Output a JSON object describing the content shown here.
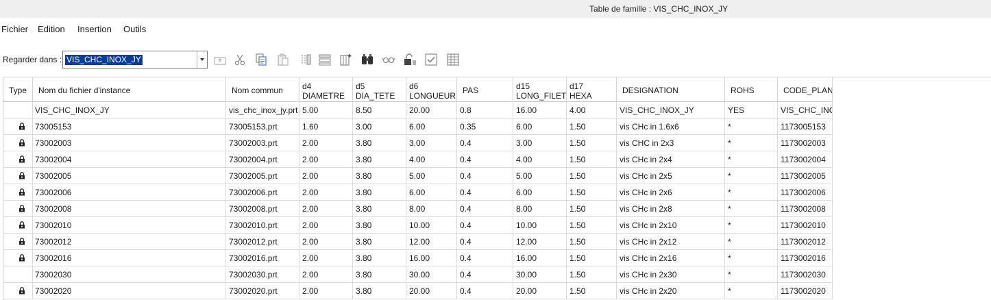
{
  "window": {
    "title": "Table de famille : VIS_CHC_INOX_JY"
  },
  "menu": {
    "items": [
      "Fichier",
      "Edition",
      "Insertion",
      "Outils"
    ]
  },
  "toolbar": {
    "look_in_label": "Regarder dans :",
    "look_in_value": "VIS_CHC_INOX_JY",
    "icons": [
      "up-level-icon",
      "cut-icon",
      "copy-icon",
      "paste-icon",
      "insert-column-icon",
      "insert-row-icon",
      "column-properties-icon",
      "find-icon",
      "preview-icon",
      "lock-icon",
      "verify-icon",
      "table-icon"
    ]
  },
  "table": {
    "columns": [
      {
        "key": "type",
        "line1": "Type",
        "line2": ""
      },
      {
        "key": "instance",
        "line1": "Nom du fichier d'instance",
        "line2": ""
      },
      {
        "key": "common",
        "line1": "Nom commun",
        "line2": ""
      },
      {
        "key": "d4",
        "line1": "d4",
        "line2": "DIAMETRE"
      },
      {
        "key": "d5",
        "line1": "d5",
        "line2": "DIA_TETE"
      },
      {
        "key": "d6",
        "line1": "d6",
        "line2": "LONGUEUR"
      },
      {
        "key": "pas",
        "line1": "PAS",
        "line2": ""
      },
      {
        "key": "d15",
        "line1": "d15",
        "line2": "LONG_FILET"
      },
      {
        "key": "d17",
        "line1": "d17",
        "line2": "HEXA"
      },
      {
        "key": "designation",
        "line1": "DESIGNATION",
        "line2": ""
      },
      {
        "key": "rohs",
        "line1": "ROHS",
        "line2": ""
      },
      {
        "key": "code",
        "line1": "CODE_PLAN",
        "line2": ""
      }
    ],
    "rows": [
      {
        "locked": false,
        "cells": [
          "",
          "VIS_CHC_INOX_JY",
          "vis_chc_inox_jy.prt",
          "5.00",
          "8.50",
          "20.00",
          "0.8",
          "16.00",
          "4.00",
          "VIS_CHC_INOX_JY",
          "YES",
          "VIS_CHC_INO"
        ]
      },
      {
        "locked": true,
        "cells": [
          "",
          "73005153",
          "73005153.prt",
          "1.60",
          "3.00",
          "6.00",
          "0.35",
          "6.00",
          "1.50",
          "vis CHc in 1.6x6",
          "*",
          "1173005153"
        ]
      },
      {
        "locked": true,
        "cells": [
          "",
          "73002003",
          "73002003.prt",
          "2.00",
          "3.80",
          "3.00",
          "0.4",
          "3.00",
          "1.50",
          "vis CHC in 2x3",
          "*",
          "1173002003"
        ]
      },
      {
        "locked": true,
        "cells": [
          "",
          "73002004",
          "73002004.prt",
          "2.00",
          "3.80",
          "4.00",
          "0.4",
          "4.00",
          "1.50",
          "vis CHc in 2x4",
          "*",
          "1173002004"
        ]
      },
      {
        "locked": true,
        "cells": [
          "",
          "73002005",
          "73002005.prt",
          "2.00",
          "3.80",
          "5.00",
          "0.4",
          "5.00",
          "1.50",
          "vis CHc in 2x5",
          "*",
          "1173002005"
        ]
      },
      {
        "locked": true,
        "cells": [
          "",
          "73002006",
          "73002006.prt",
          "2.00",
          "3.80",
          "6.00",
          "0.4",
          "6.00",
          "1.50",
          "vis CHc in 2x6",
          "*",
          "1173002006"
        ]
      },
      {
        "locked": true,
        "cells": [
          "",
          "73002008",
          "73002008.prt",
          "2.00",
          "3.80",
          "8.00",
          "0.4",
          "8.00",
          "1.50",
          "vis CHc in 2x8",
          "*",
          "1173002008"
        ]
      },
      {
        "locked": true,
        "cells": [
          "",
          "73002010",
          "73002010.prt",
          "2.00",
          "3.80",
          "10.00",
          "0.4",
          "10.00",
          "1.50",
          "vis CHc in 2x10",
          "*",
          "1173002010"
        ]
      },
      {
        "locked": true,
        "cells": [
          "",
          "73002012",
          "73002012.prt",
          "2.00",
          "3.80",
          "12.00",
          "0.4",
          "12.00",
          "1.50",
          "vis CHc in 2x12",
          "*",
          "1173002012"
        ]
      },
      {
        "locked": true,
        "cells": [
          "",
          "73002016",
          "73002016.prt",
          "2.00",
          "3.80",
          "16.00",
          "0.4",
          "16.00",
          "1.50",
          "vis CHc in 2x16",
          "*",
          "1173002016"
        ]
      },
      {
        "locked": false,
        "cells": [
          "",
          "73002030",
          "73002030.prt",
          "2.00",
          "3.80",
          "30.00",
          "0.4",
          "30.00",
          "1.50",
          "vis CHc in 2x30",
          "*",
          "1173002030"
        ]
      },
      {
        "locked": true,
        "cells": [
          "",
          "73002020",
          "73002020.prt",
          "2.00",
          "3.80",
          "20.00",
          "0.4",
          "20.00",
          "1.50",
          "vis CHc in 2x20",
          "*",
          "1173002020"
        ]
      }
    ]
  }
}
